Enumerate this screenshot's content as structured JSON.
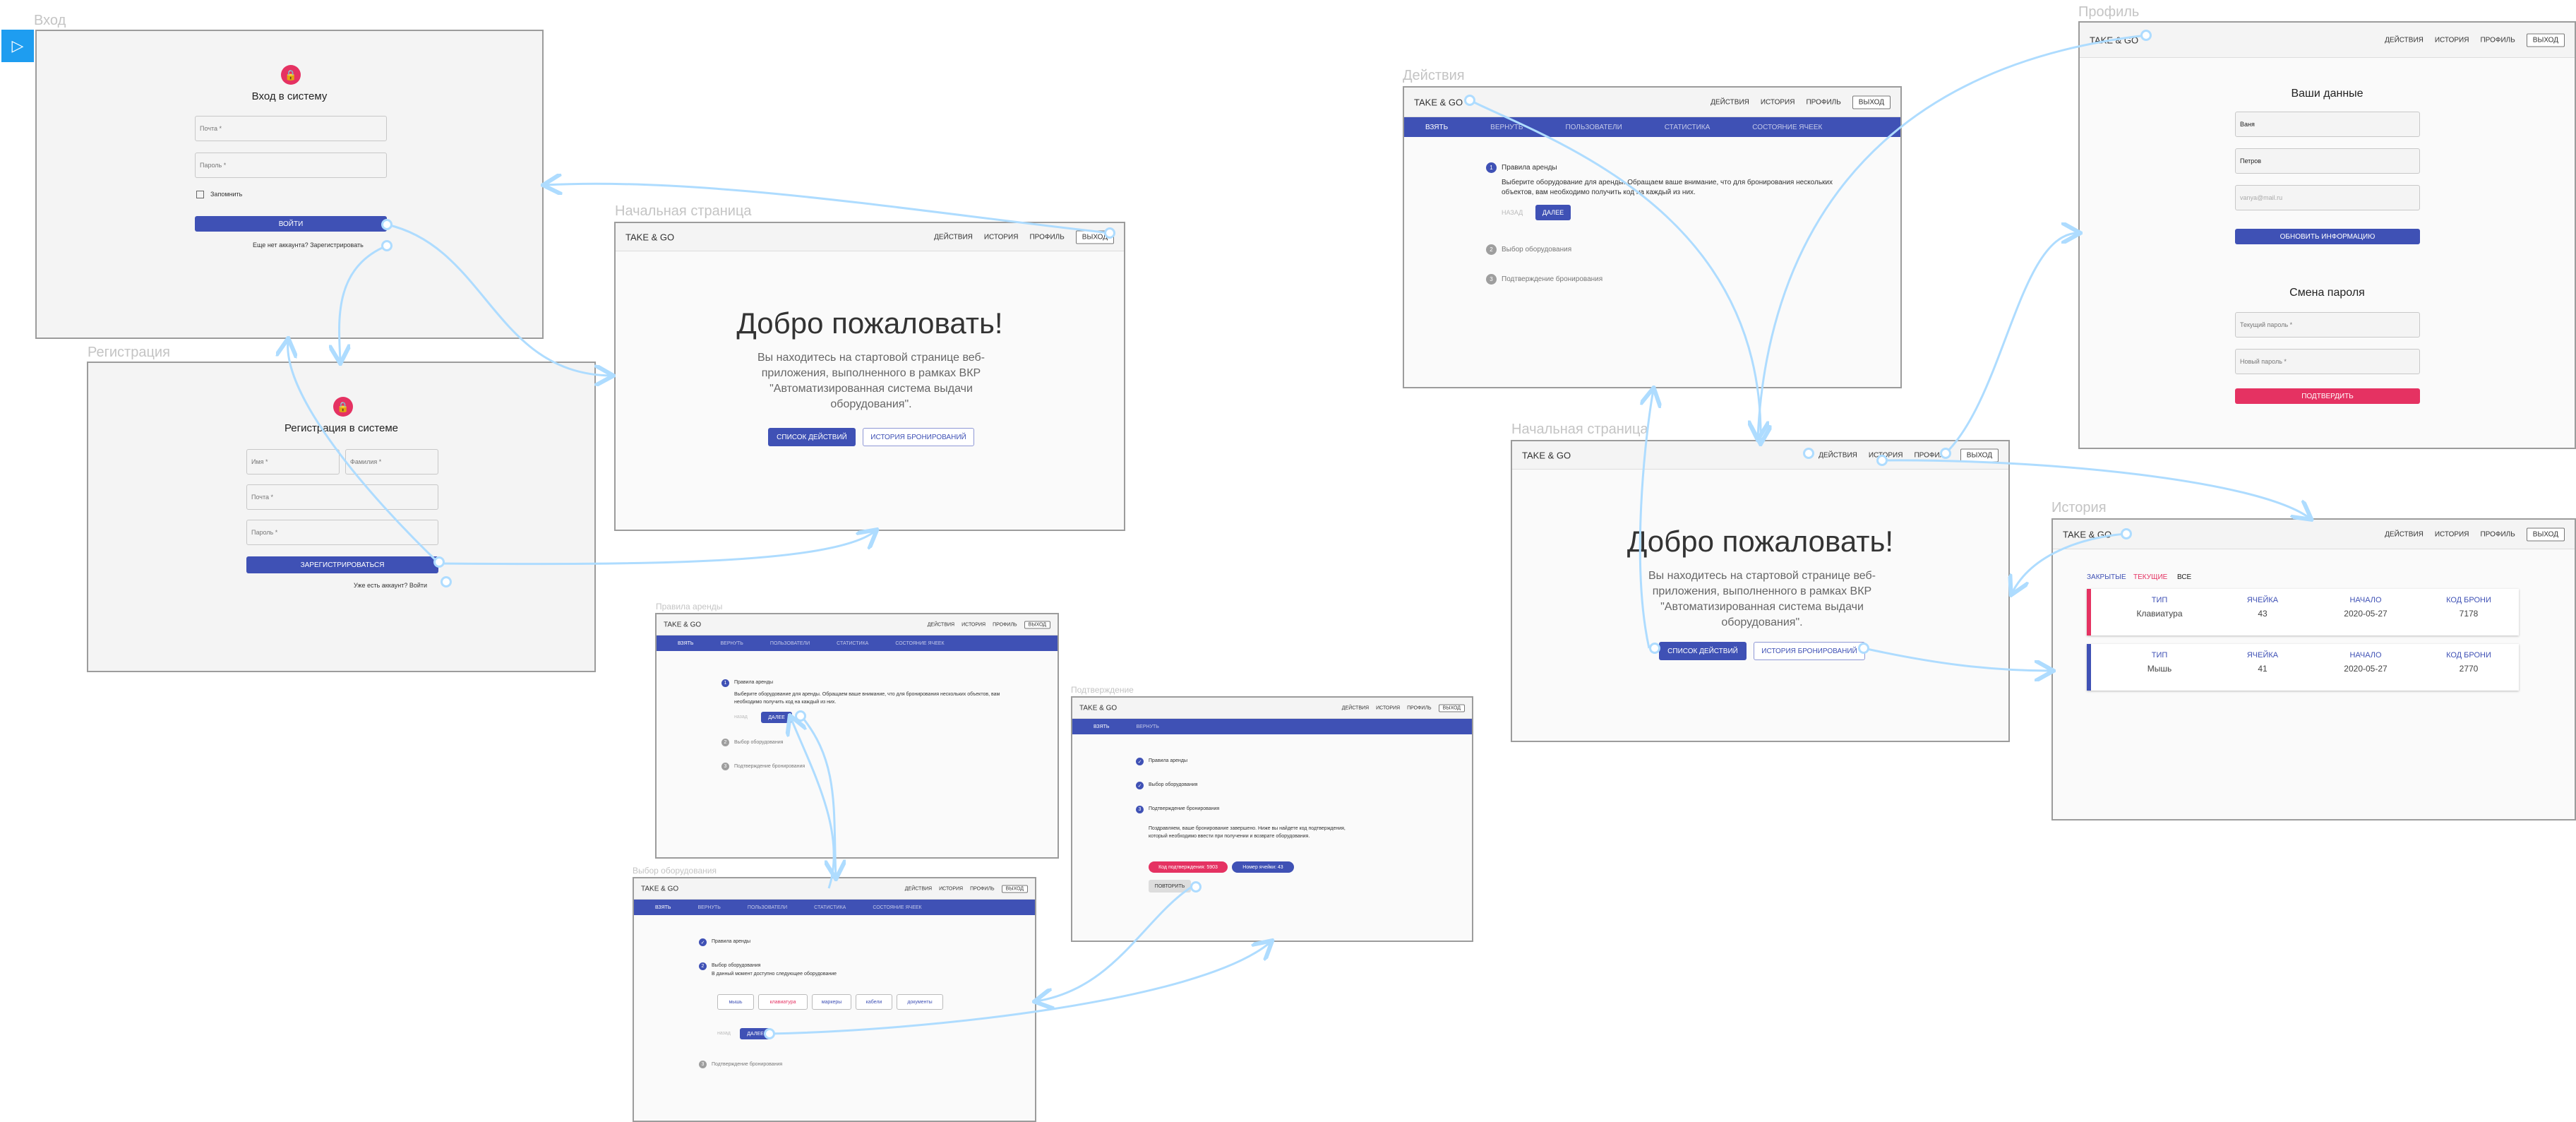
{
  "labels": {
    "login": "Вход",
    "register": "Регистрация",
    "home1": "Начальная страница",
    "rules": "Правила аренды",
    "choose": "Выбор оборудования",
    "confirm": "Подтверждение",
    "actions": "Действия",
    "home2": "Начальная страница",
    "profile": "Профиль",
    "history": "История"
  },
  "app": {
    "logo": "TAKE & GO"
  },
  "nav": {
    "actions": "действия",
    "history": "история",
    "profile": "профиль",
    "logout": "выход"
  },
  "tabs": [
    "взять",
    "вернуть",
    "пользователи",
    "статистика",
    "состояние ячеек"
  ],
  "tabs_short": [
    "взять",
    "вернуть"
  ],
  "login": {
    "title": "Вход в систему",
    "email": "Почта *",
    "password": "Пароль *",
    "remember": "Запомнить",
    "submit": "войти",
    "no_account": "Еще нет аккаунта? Зарегистрировать"
  },
  "register": {
    "title": "Регистрация в системе",
    "name": "Имя *",
    "surname": "Фамилия *",
    "email": "Почта *",
    "password": "Пароль *",
    "submit": "зарегистрироваться",
    "have_account": "Уже есть аккаунт? Войти"
  },
  "home": {
    "welcome": "Добро пожаловать!",
    "text": "Вы находитесь на стартовой странице веб-приложения, выполненного в рамках ВКР \"Автоматизированная система выдачи оборудования\".",
    "btn_actions": "список действий",
    "btn_history": "история бронирований"
  },
  "steps": {
    "rules": "Правила аренды",
    "rules_text": "Выберите оборудование для аренды. Обращаем ваше внимание, что для бронирования нескольких объектов, вам необходимо получить код на каждый из них.",
    "back": "назад",
    "next": "далее",
    "choose": "Выбор оборудования",
    "choose_text": "В данный момент доступно следующее оборудование",
    "confirm": "Подтверждение бронирования",
    "confirm_text": "Поздравляем, ваше бронирование завершено. Ниже вы найдете код подтверждения, который необходимо ввести при получении и возврате оборудования.",
    "code": "Код подтверждения: 5903",
    "cell": "Номер ячейки: 43",
    "repeat": "повторить"
  },
  "equipment": [
    "мышь",
    "клавиатура",
    "маркеры",
    "кабели",
    "документы"
  ],
  "profile": {
    "title": "Ваши данные",
    "name_label": "Имя *",
    "name": "Ваня",
    "surname_label": "Фамилия *",
    "surname": "Петров",
    "email_label": "Email *",
    "email": "vanya@mail.ru",
    "update": "обновить информацию",
    "pw_title": "Смена пароля",
    "current_pw": "Текущий пароль *",
    "new_pw": "Новый пароль *",
    "confirm": "подтвердить"
  },
  "history": {
    "filters": [
      "закрытые",
      "текущие",
      "все"
    ],
    "headers": [
      "тип",
      "ячейка",
      "начало",
      "код брони"
    ],
    "rows": [
      {
        "type": "Клавиатура",
        "cell": "43",
        "start": "2020-05-27",
        "code": "7178",
        "color": "#e53262"
      },
      {
        "type": "Мышь",
        "cell": "41",
        "start": "2020-05-27",
        "code": "2770",
        "color": "#3f51b5"
      }
    ]
  },
  "colors": {
    "primary": "#3f51b5",
    "accent": "#e53262",
    "connector": "#aedcff"
  }
}
